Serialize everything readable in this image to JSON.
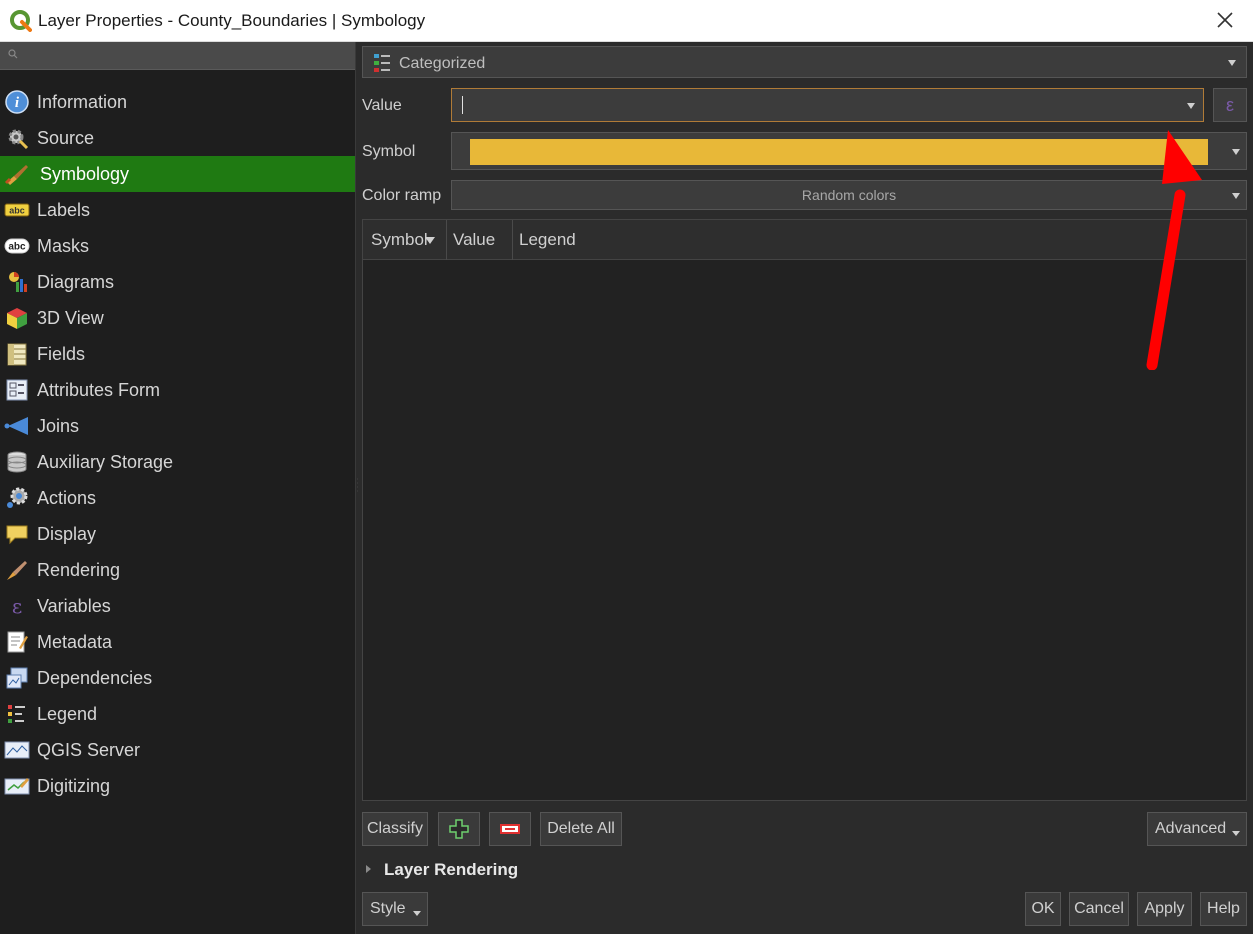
{
  "window": {
    "title": "Layer Properties - County_Boundaries | Symbology"
  },
  "sidebar": {
    "search_placeholder": "",
    "items": [
      {
        "label": "Information",
        "icon": "info-icon"
      },
      {
        "label": "Source",
        "icon": "source-icon"
      },
      {
        "label": "Symbology",
        "icon": "symbology-icon",
        "active": true
      },
      {
        "label": "Labels",
        "icon": "labels-icon"
      },
      {
        "label": "Masks",
        "icon": "masks-icon"
      },
      {
        "label": "Diagrams",
        "icon": "diagrams-icon"
      },
      {
        "label": "3D View",
        "icon": "3d-view-icon"
      },
      {
        "label": "Fields",
        "icon": "fields-icon"
      },
      {
        "label": "Attributes Form",
        "icon": "attributes-form-icon"
      },
      {
        "label": "Joins",
        "icon": "joins-icon"
      },
      {
        "label": "Auxiliary Storage",
        "icon": "auxiliary-storage-icon"
      },
      {
        "label": "Actions",
        "icon": "actions-icon"
      },
      {
        "label": "Display",
        "icon": "display-icon"
      },
      {
        "label": "Rendering",
        "icon": "rendering-icon"
      },
      {
        "label": "Variables",
        "icon": "variables-icon"
      },
      {
        "label": "Metadata",
        "icon": "metadata-icon"
      },
      {
        "label": "Dependencies",
        "icon": "dependencies-icon"
      },
      {
        "label": "Legend",
        "icon": "legend-icon"
      },
      {
        "label": "QGIS Server",
        "icon": "qgis-server-icon"
      },
      {
        "label": "Digitizing",
        "icon": "digitizing-icon"
      }
    ]
  },
  "symbology": {
    "renderer": "Categorized",
    "value_label": "Value",
    "value": "",
    "symbol_label": "Symbol",
    "symbol_color": "#e8b838",
    "color_ramp_label": "Color ramp",
    "color_ramp": "Random colors",
    "table_headers": [
      "Symbol",
      "Value",
      "Legend"
    ],
    "buttons": {
      "classify": "Classify",
      "delete_all": "Delete All",
      "advanced": "Advanced"
    },
    "layer_rendering": "Layer Rendering"
  },
  "footer": {
    "style": "Style",
    "ok": "OK",
    "cancel": "Cancel",
    "apply": "Apply",
    "help": "Help"
  },
  "colors": {
    "accent_active": "#1f7a12",
    "annotation_arrow": "#ff0000",
    "value_border": "#b07b37"
  }
}
